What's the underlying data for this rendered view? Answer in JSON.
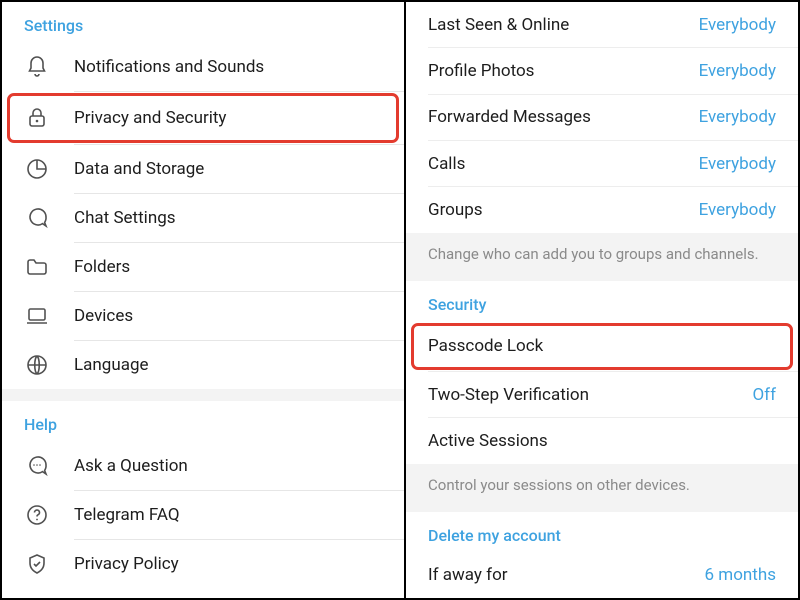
{
  "left": {
    "settings_header": "Settings",
    "items": [
      {
        "label": "Notifications and Sounds"
      },
      {
        "label": "Privacy and Security"
      },
      {
        "label": "Data and Storage"
      },
      {
        "label": "Chat Settings"
      },
      {
        "label": "Folders"
      },
      {
        "label": "Devices"
      },
      {
        "label": "Language"
      }
    ],
    "help_header": "Help",
    "help_items": [
      {
        "label": "Ask a Question"
      },
      {
        "label": "Telegram FAQ"
      },
      {
        "label": "Privacy Policy"
      }
    ]
  },
  "right": {
    "privacy_items": [
      {
        "label": "Last Seen & Online",
        "value": "Everybody"
      },
      {
        "label": "Profile Photos",
        "value": "Everybody"
      },
      {
        "label": "Forwarded Messages",
        "value": "Everybody"
      },
      {
        "label": "Calls",
        "value": "Everybody"
      },
      {
        "label": "Groups",
        "value": "Everybody"
      }
    ],
    "privacy_footer": "Change who can add you to groups and channels.",
    "security_header": "Security",
    "security_items": [
      {
        "label": "Passcode Lock",
        "value": ""
      },
      {
        "label": "Two-Step Verification",
        "value": "Off"
      },
      {
        "label": "Active Sessions",
        "value": ""
      }
    ],
    "security_footer": "Control your sessions on other devices.",
    "delete_header": "Delete my account",
    "delete_item": {
      "label": "If away for",
      "value": "6 months"
    }
  }
}
